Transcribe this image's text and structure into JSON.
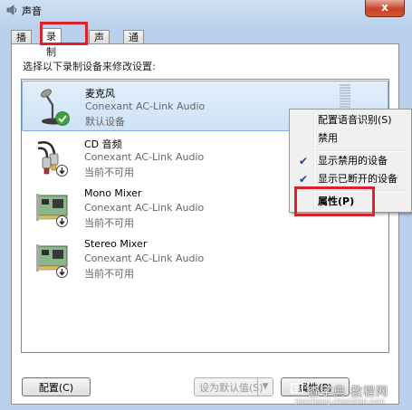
{
  "window": {
    "title": "声音",
    "close_label": "x"
  },
  "tabs": [
    {
      "label": "播放"
    },
    {
      "label": "录制",
      "active": true
    },
    {
      "label": "声音"
    },
    {
      "label": "通信"
    }
  ],
  "panel": {
    "prompt": "选择以下录制设备来修改设置:"
  },
  "devices": [
    {
      "name": "麦克风",
      "description": "Conexant AC-Link Audio",
      "status": "默认设备",
      "icon": "microphone-icon",
      "badge": "default-check-icon",
      "selected": true
    },
    {
      "name": "CD 音频",
      "description": "Conexant AC-Link Audio",
      "status": "当前不可用",
      "icon": "audio-cable-icon",
      "badge": "unavailable-arrow-icon"
    },
    {
      "name": "Mono Mixer",
      "description": "Conexant AC-Link Audio",
      "status": "当前不可用",
      "icon": "sound-card-icon",
      "badge": "unavailable-arrow-icon"
    },
    {
      "name": "Stereo Mixer",
      "description": "Conexant AC-Link Audio",
      "status": "当前不可用",
      "icon": "sound-card-icon",
      "badge": "unavailable-arrow-icon"
    }
  ],
  "buttons": {
    "configure": "配置(C)",
    "set_default": "设为默认值(S)",
    "properties": "属性(P)"
  },
  "context_menu": {
    "items": [
      {
        "label": "配置语音识别(S)"
      },
      {
        "label": "禁用"
      },
      {
        "label": "显示禁用的设备",
        "checked": true
      },
      {
        "label": "显示已断开的设备",
        "checked": true
      },
      {
        "label": "属性(P)",
        "bold": true
      }
    ]
  },
  "watermark": {
    "line1": "查字典 教程网",
    "line2": "jiaocheng.chazidian.com"
  },
  "colors": {
    "highlight_box": "#d8232a",
    "selection_bg": "#cde2f8",
    "check_badge": "#3da23d"
  }
}
